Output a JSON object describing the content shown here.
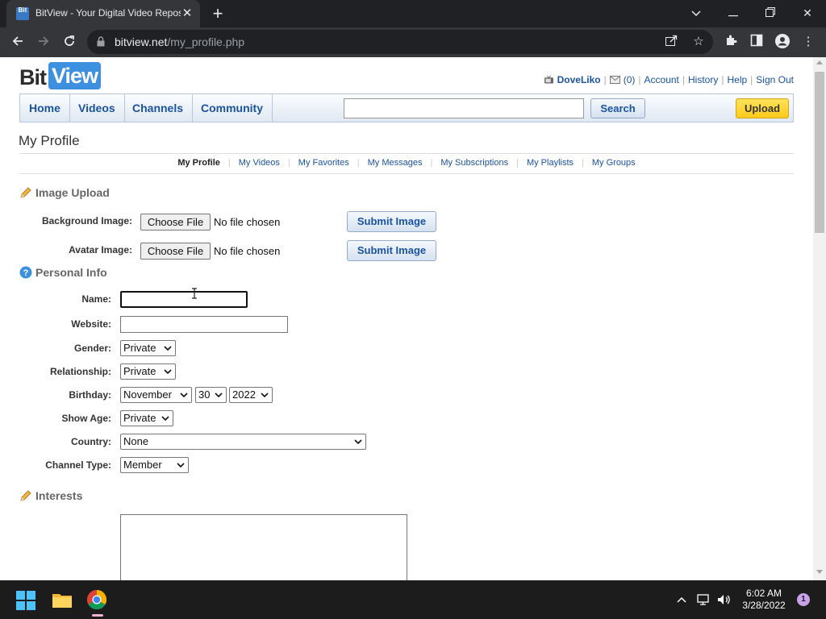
{
  "browser": {
    "tab_title": "BitView - Your Digital Video Repository",
    "favicon_text": "Bit",
    "url_host": "bitview.net",
    "url_path": "/my_profile.php"
  },
  "site": {
    "logo_bit": "Bit",
    "logo_view": "View",
    "username": "DoveLiko",
    "message_count": "(0)",
    "user_links": [
      "Account",
      "History",
      "Help",
      "Sign Out"
    ],
    "nav": [
      "Home",
      "Videos",
      "Channels",
      "Community"
    ],
    "search_button": "Search",
    "upload_button": "Upload"
  },
  "page": {
    "title": "My Profile",
    "subnav": [
      "My Profile",
      "My Videos",
      "My Favorites",
      "My Messages",
      "My Subscriptions",
      "My Playlists",
      "My Groups"
    ],
    "active_subnav": "My Profile"
  },
  "image_upload": {
    "heading": "Image Upload",
    "background_label": "Background Image:",
    "avatar_label": "Avatar Image:",
    "choose_file": "Choose File",
    "no_file": "No file chosen",
    "submit": "Submit Image"
  },
  "personal_info": {
    "heading": "Personal Info",
    "name_label": "Name:",
    "name_value": "",
    "website_label": "Website:",
    "website_value": "",
    "gender_label": "Gender:",
    "gender_value": "Private",
    "relationship_label": "Relationship:",
    "relationship_value": "Private",
    "birthday_label": "Birthday:",
    "birthday_month": "November",
    "birthday_day": "30",
    "birthday_year": "2022",
    "show_age_label": "Show Age:",
    "show_age_value": "Private",
    "country_label": "Country:",
    "country_value": "None",
    "channel_type_label": "Channel Type:",
    "channel_type_value": "Member"
  },
  "interests": {
    "heading": "Interests",
    "value": ""
  },
  "taskbar": {
    "time": "6:02 AM",
    "date": "3/28/2022",
    "notification_count": "1"
  },
  "colors": {
    "link_blue": "#1a53a0",
    "logo_blue": "#3d8fe0",
    "upload_yellow": "#ffcb1a"
  }
}
